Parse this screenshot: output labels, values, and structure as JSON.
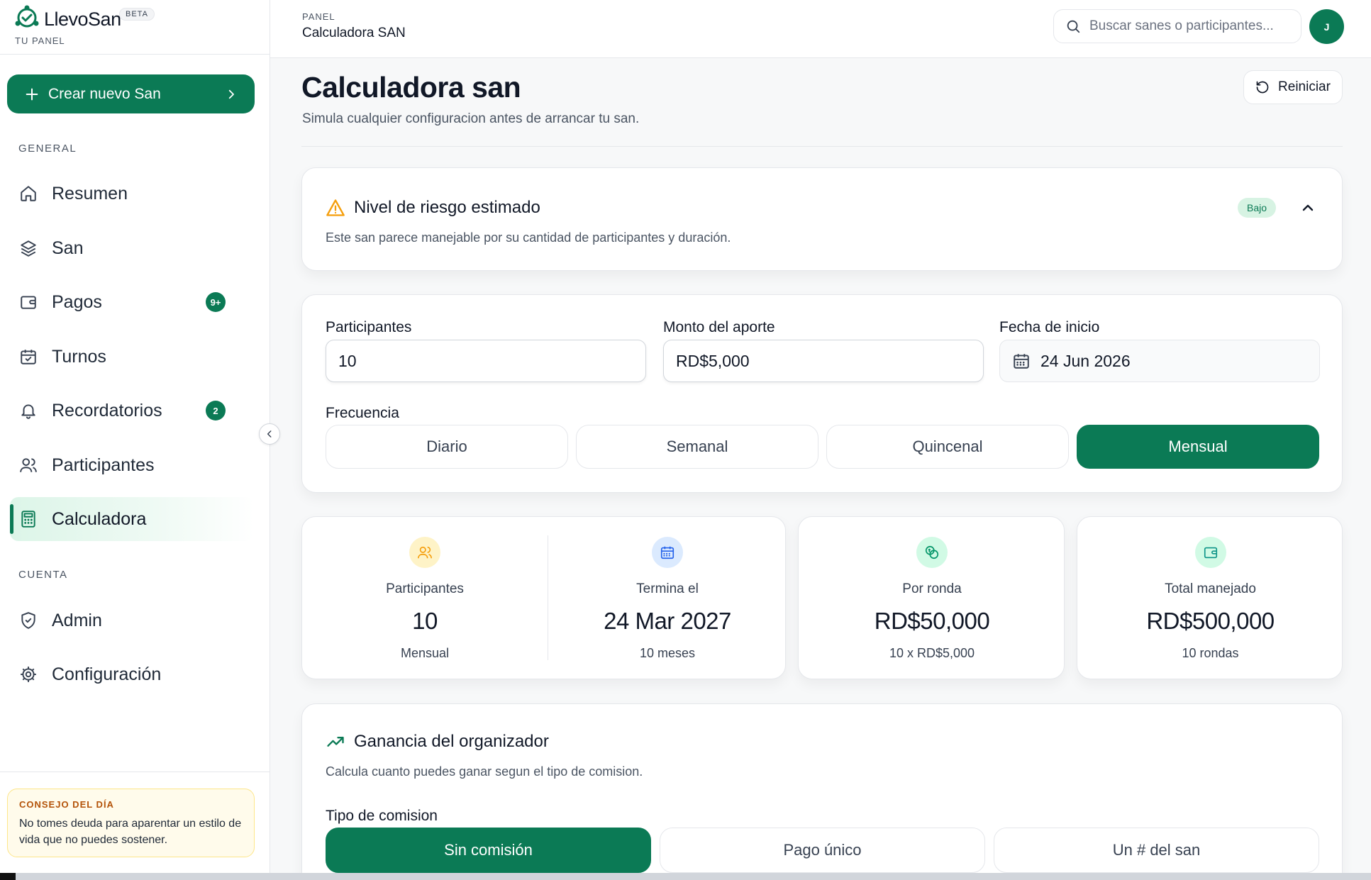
{
  "brand": {
    "name": "LlevoSan",
    "badge": "BETA",
    "subtitle": "TU PANEL"
  },
  "sidebar": {
    "create_label": "Crear nuevo San",
    "section_general": "GENERAL",
    "section_cuenta": "CUENTA",
    "items": [
      {
        "label": "Resumen",
        "icon": "home-icon"
      },
      {
        "label": "San",
        "icon": "layers-icon"
      },
      {
        "label": "Pagos",
        "icon": "wallet-icon",
        "badge": "9+"
      },
      {
        "label": "Turnos",
        "icon": "calendar-check-icon"
      },
      {
        "label": "Recordatorios",
        "icon": "bell-icon",
        "badge": "2"
      },
      {
        "label": "Participantes",
        "icon": "users-icon"
      },
      {
        "label": "Calculadora",
        "icon": "calculator-icon",
        "active": true
      }
    ],
    "account_items": [
      {
        "label": "Admin",
        "icon": "shield-check-icon"
      },
      {
        "label": "Configuración",
        "icon": "gear-icon"
      }
    ],
    "tip": {
      "title": "CONSEJO DEL DÍA",
      "text": "No tomes deuda para aparentar un estilo de vida que no puedes sostener."
    }
  },
  "header": {
    "breadcrumb_small": "PANEL",
    "breadcrumb_title": "Calculadora SAN",
    "search_placeholder": "Buscar sanes o participantes...",
    "avatar_initial": "J"
  },
  "page": {
    "title": "Calculadora san",
    "subtitle": "Simula cualquier configuracion antes de arrancar tu san.",
    "reset_label": "Reiniciar"
  },
  "risk": {
    "title": "Nivel de riesgo estimado",
    "description": "Este san parece manejable por su cantidad de participantes y duración.",
    "level": "Bajo"
  },
  "form": {
    "participants_label": "Participantes",
    "participants_value": "10",
    "amount_label": "Monto del aporte",
    "amount_value": "RD$5,000",
    "date_label": "Fecha de inicio",
    "date_value": "24 Jun 2026",
    "frequency_label": "Frecuencia",
    "frequencies": [
      "Diario",
      "Semanal",
      "Quincenal",
      "Mensual"
    ],
    "selected_frequency": "Mensual"
  },
  "stats": [
    {
      "label": "Participantes",
      "value": "10",
      "sub": "Mensual",
      "icon": "users-icon"
    },
    {
      "label": "Termina el",
      "value": "24 Mar 2027",
      "sub": "10 meses",
      "icon": "calendar-icon"
    },
    {
      "label": "Por ronda",
      "value": "RD$50,000",
      "sub": "10 x RD$5,000",
      "icon": "coins-icon"
    },
    {
      "label": "Total manejado",
      "value": "RD$500,000",
      "sub": "10 rondas",
      "icon": "wallet-icon"
    }
  ],
  "gain": {
    "title": "Ganancia del organizador",
    "description": "Calcula cuanto puedes ganar segun el tipo de comision.",
    "commission_label": "Tipo de comision",
    "options": [
      "Sin comisión",
      "Pago único",
      "Un # del san"
    ],
    "selected": "Sin comisión"
  },
  "colors": {
    "accent": "#0b7a55",
    "warning": "#f59e0b",
    "tip_bg": "#fffbeb"
  }
}
